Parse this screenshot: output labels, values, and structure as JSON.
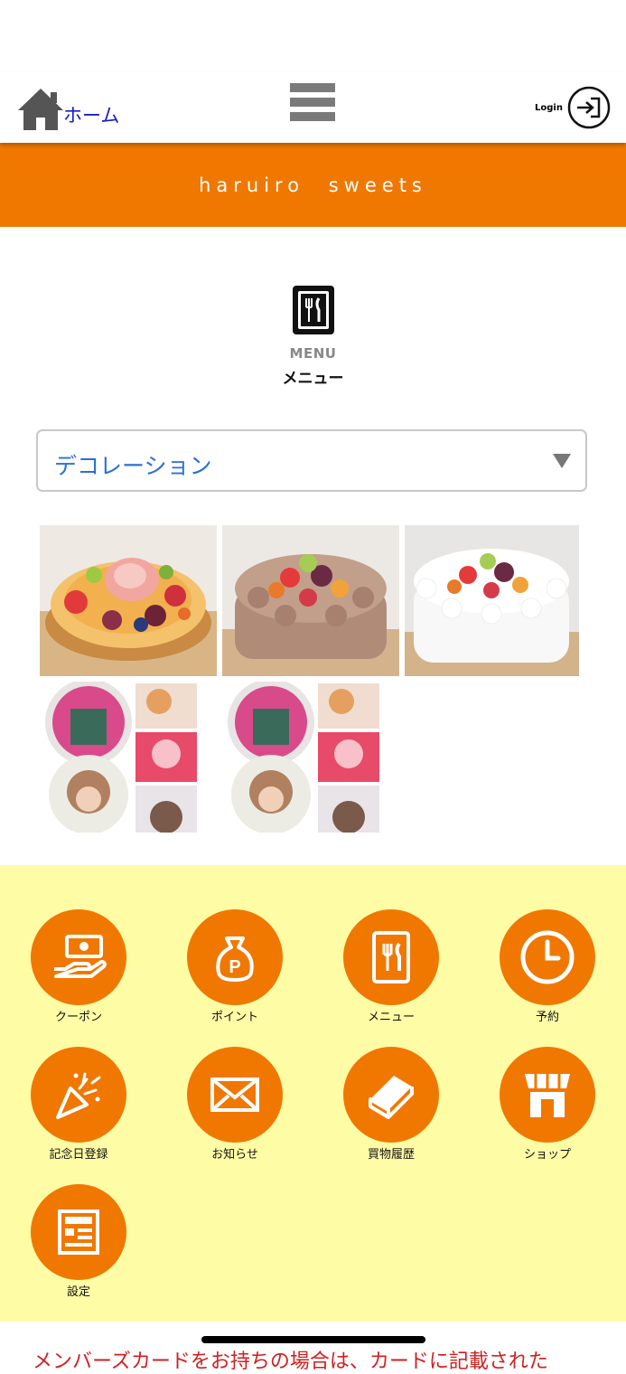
{
  "header": {
    "home_label": "ホーム",
    "login_label": "Login"
  },
  "banner": {
    "title": "haruiro sweets"
  },
  "menu_heading": {
    "en": "MENU",
    "ja": "メニュー"
  },
  "category_select": {
    "selected": "デコレーション"
  },
  "products": [
    {
      "name": "fruit-tart"
    },
    {
      "name": "chocolate-cream-fruit-cake"
    },
    {
      "name": "white-cream-fruit-cake"
    },
    {
      "name": "character-photo-cake"
    },
    {
      "name": "character-photo-cake"
    }
  ],
  "nav": {
    "items": [
      {
        "label": "クーポン",
        "icon": "coupon-icon"
      },
      {
        "label": "ポイント",
        "icon": "point-bag-icon"
      },
      {
        "label": "メニュー",
        "icon": "menu-book-icon"
      },
      {
        "label": "予約",
        "icon": "clock-icon"
      },
      {
        "label": "記念日登録",
        "icon": "party-popper-icon"
      },
      {
        "label": "お知らせ",
        "icon": "envelope-icon"
      },
      {
        "label": "買物履歴",
        "icon": "book-history-icon"
      },
      {
        "label": "ショップ",
        "icon": "shop-icon"
      },
      {
        "label": "設定",
        "icon": "settings-form-icon"
      }
    ]
  },
  "notice": "メンバーズカードをお持ちの場合は、カードに記載された",
  "colors": {
    "brand": "#f07800",
    "panel": "#fffca6",
    "link": "#2a6fd6"
  }
}
